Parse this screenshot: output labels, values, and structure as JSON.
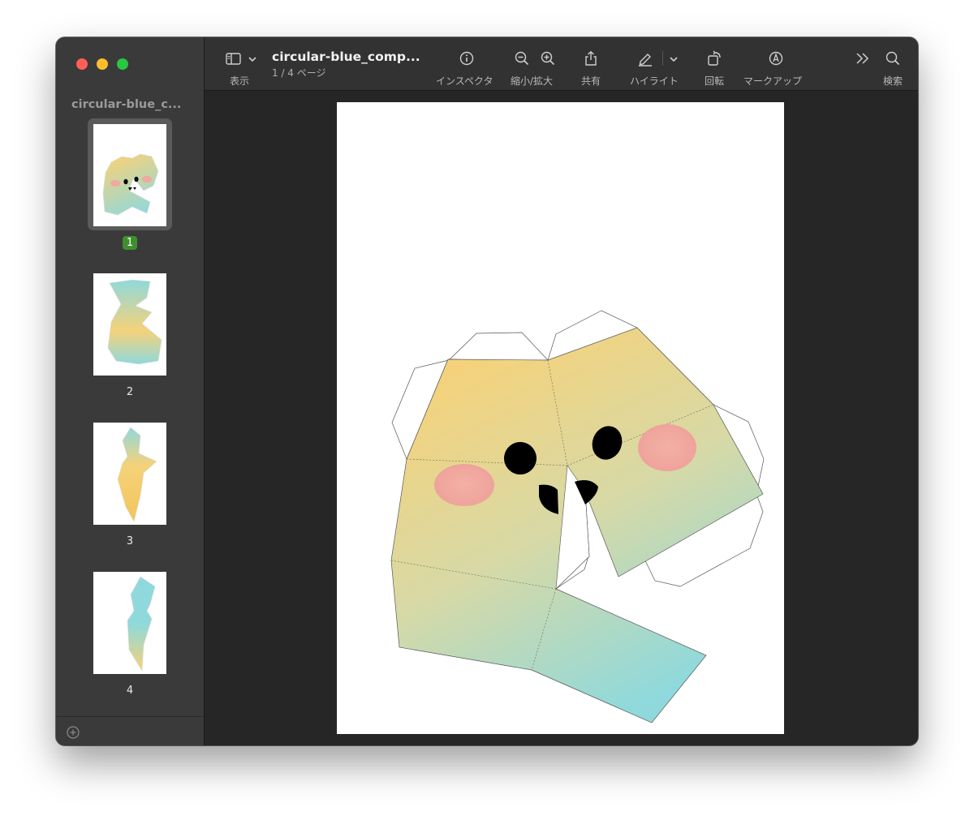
{
  "window": {
    "sidebar_title": "circular-blue_c...",
    "document_title": "circular-blue_comp....",
    "page_status": "1 / 4 ページ"
  },
  "toolbar": {
    "view_label": "表示",
    "inspector_label": "インスペクタ",
    "zoom_label": "縮小/拡大",
    "share_label": "共有",
    "highlight_label": "ハイライト",
    "rotate_label": "回転",
    "markup_label": "マークアップ",
    "search_label": "検索"
  },
  "sidebar": {
    "pages": [
      {
        "number": "1",
        "selected": true
      },
      {
        "number": "2",
        "selected": false
      },
      {
        "number": "3",
        "selected": false
      },
      {
        "number": "4",
        "selected": false
      }
    ]
  },
  "colors": {
    "gradient_yellow": "#f5d27a",
    "gradient_blue": "#8fd9dc",
    "cheek_pink": "#f0a8a0",
    "selected_page_badge": "#3f8f2e"
  }
}
